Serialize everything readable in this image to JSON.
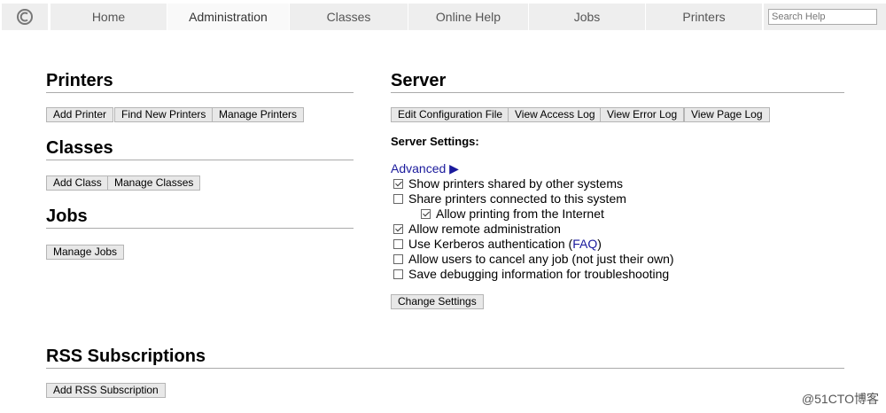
{
  "nav": {
    "logo_icon": "cups-logo-icon",
    "tabs": [
      {
        "label": "Home",
        "active": false
      },
      {
        "label": "Administration",
        "active": true
      },
      {
        "label": "Classes",
        "active": false
      },
      {
        "label": "Online Help",
        "active": false
      },
      {
        "label": "Jobs",
        "active": false
      },
      {
        "label": "Printers",
        "active": false
      }
    ],
    "search_placeholder": "Search Help"
  },
  "printers": {
    "heading": "Printers",
    "buttons": [
      "Add Printer",
      "Find New Printers",
      "Manage Printers"
    ]
  },
  "classes": {
    "heading": "Classes",
    "buttons": [
      "Add Class",
      "Manage Classes"
    ]
  },
  "jobs": {
    "heading": "Jobs",
    "buttons": [
      "Manage Jobs"
    ]
  },
  "server": {
    "heading": "Server",
    "buttons": [
      "Edit Configuration File",
      "View Access Log",
      "View Error Log",
      "View Page Log"
    ],
    "settings_label": "Server Settings:",
    "advanced_link": "Advanced ▶",
    "options": [
      {
        "label": "Show printers shared by other systems",
        "checked": true
      },
      {
        "label": "Share printers connected to this system",
        "checked": false
      },
      {
        "label": "Allow printing from the Internet",
        "checked": true
      },
      {
        "label": "Allow remote administration",
        "checked": true
      },
      {
        "label": "Use Kerberos authentication (",
        "link": "FAQ",
        "suffix": ")",
        "checked": false
      },
      {
        "label": "Allow users to cancel any job (not just their own)",
        "checked": false
      },
      {
        "label": "Save debugging information for troubleshooting",
        "checked": false
      }
    ],
    "change_button": "Change Settings"
  },
  "rss": {
    "heading": "RSS Subscriptions",
    "buttons": [
      "Add RSS Subscription"
    ]
  },
  "watermark": "@51CTO博客"
}
